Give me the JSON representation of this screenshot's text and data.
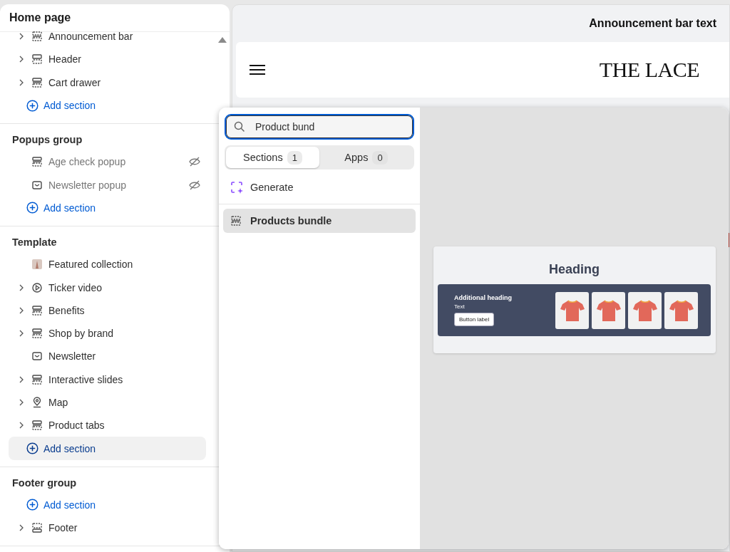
{
  "sidebar": {
    "title": "Home page",
    "groups": [
      {
        "items": [
          {
            "kind": "dashed-bar",
            "label": "Announcement bar",
            "expandable": true,
            "hidden": false
          },
          {
            "kind": "header",
            "label": "Header",
            "expandable": true,
            "hidden": false
          },
          {
            "kind": "rows",
            "label": "Cart drawer",
            "expandable": true,
            "hidden": false
          },
          {
            "kind": "add",
            "label": "Add section",
            "highlighted": false
          }
        ]
      },
      {
        "title": "Popups group",
        "items": [
          {
            "kind": "rows",
            "label": "Age check popup",
            "expandable": false,
            "hidden": true
          },
          {
            "kind": "mail",
            "label": "Newsletter popup",
            "expandable": false,
            "hidden": true
          },
          {
            "kind": "add",
            "label": "Add section",
            "highlighted": false
          }
        ]
      },
      {
        "title": "Template",
        "items": [
          {
            "kind": "image",
            "label": "Featured collection",
            "expandable": false,
            "hidden": false
          },
          {
            "kind": "play",
            "label": "Ticker video",
            "expandable": true,
            "hidden": false
          },
          {
            "kind": "rows",
            "label": "Benefits",
            "expandable": true,
            "hidden": false
          },
          {
            "kind": "rows",
            "label": "Shop by brand",
            "expandable": true,
            "hidden": false
          },
          {
            "kind": "mail",
            "label": "Newsletter",
            "expandable": false,
            "hidden": false
          },
          {
            "kind": "rows",
            "label": "Interactive slides",
            "expandable": true,
            "hidden": false
          },
          {
            "kind": "pin",
            "label": "Map",
            "expandable": true,
            "hidden": false
          },
          {
            "kind": "rows",
            "label": "Product tabs",
            "expandable": true,
            "hidden": false
          },
          {
            "kind": "add",
            "label": "Add section",
            "highlighted": true
          }
        ]
      },
      {
        "title": "Footer group",
        "items": [
          {
            "kind": "add",
            "label": "Add section",
            "highlighted": false
          },
          {
            "kind": "footer",
            "label": "Footer",
            "expandable": true,
            "hidden": false
          }
        ]
      }
    ]
  },
  "preview": {
    "announcement": "Announcement bar text",
    "logo": "THE LACE"
  },
  "picker": {
    "search": {
      "value": "Product bund"
    },
    "tabs": [
      {
        "label": "Sections",
        "count": "1",
        "selected": true
      },
      {
        "label": "Apps",
        "count": "0",
        "selected": false
      }
    ],
    "generate": "Generate",
    "results": [
      {
        "label": "Products bundle",
        "selected": true
      }
    ],
    "card": {
      "heading": "Heading",
      "subheading": "Additional heading",
      "text": "Text",
      "button": "Button label",
      "tiles": [
        {
          "kind": "tshirt"
        },
        {
          "kind": "tshirt"
        },
        {
          "kind": "tshirt"
        },
        {
          "kind": "tshirt"
        }
      ]
    }
  }
}
